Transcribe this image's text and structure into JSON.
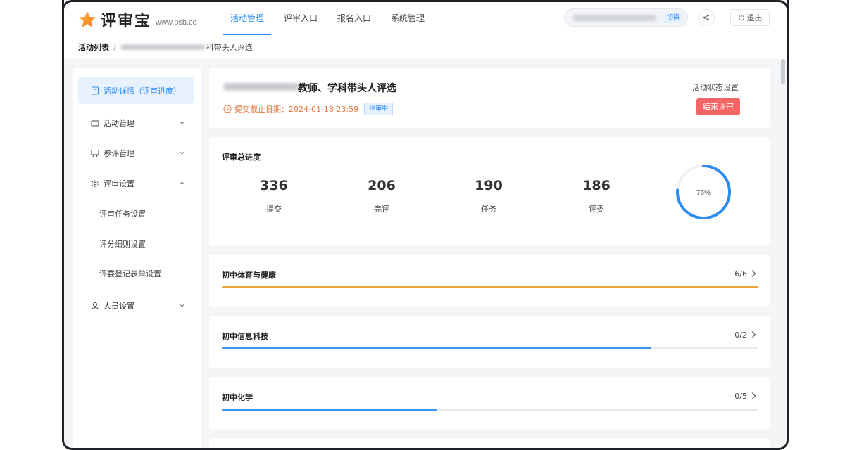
{
  "header": {
    "logo_text": "评审宝",
    "logo_url": "www.psb.cc",
    "nav": [
      {
        "label": "活动管理",
        "active": true
      },
      {
        "label": "评审入口",
        "active": false
      },
      {
        "label": "报名入口",
        "active": false
      },
      {
        "label": "系统管理",
        "active": false
      }
    ],
    "switch_label": "切换",
    "logout_label": "退出"
  },
  "breadcrumb": {
    "first": "活动列表",
    "separator": "/",
    "last": "科带头人评选"
  },
  "sidebar": {
    "items": [
      {
        "label": "活动详情（评审进度）",
        "icon": "document-icon",
        "active": true
      },
      {
        "label": "活动管理",
        "icon": "folder-icon",
        "chevron": "down"
      },
      {
        "label": "参评管理",
        "icon": "presentation-icon",
        "chevron": "down"
      },
      {
        "label": "评审设置",
        "icon": "gear-icon",
        "chevron": "up"
      },
      {
        "label": "人员设置",
        "icon": "user-icon",
        "chevron": "down"
      }
    ],
    "sub_items": [
      "评审任务设置",
      "评分细则设置",
      "评委登记表单设置"
    ]
  },
  "activity": {
    "title": "教师、学科带头人评选",
    "deadline_label": "提交截止日期：2024-01-18 23:59",
    "status_tag": "评审中",
    "status_setting_label": "活动状态设置",
    "end_button": "结束评审"
  },
  "progress": {
    "title": "评审总进度",
    "stats": [
      {
        "value": "336",
        "label": "提交"
      },
      {
        "value": "206",
        "label": "完评"
      },
      {
        "value": "190",
        "label": "任务"
      },
      {
        "value": "186",
        "label": "评委"
      }
    ],
    "percent_label": "76%",
    "percent": 0.76
  },
  "categories": [
    {
      "name": "初中体育与健康",
      "count": "6/6",
      "progress": 1.0,
      "color": "#e8a43b"
    },
    {
      "name": "初中信息科技",
      "count": "0/2",
      "progress": 0.8,
      "color": "#3a95ee"
    },
    {
      "name": "初中化学",
      "count": "0/5",
      "progress": 0.4,
      "color": "#3a95ee"
    }
  ],
  "colors": {
    "accent": "#2a8cf0",
    "danger": "#f46565",
    "warning": "#e8743b"
  }
}
